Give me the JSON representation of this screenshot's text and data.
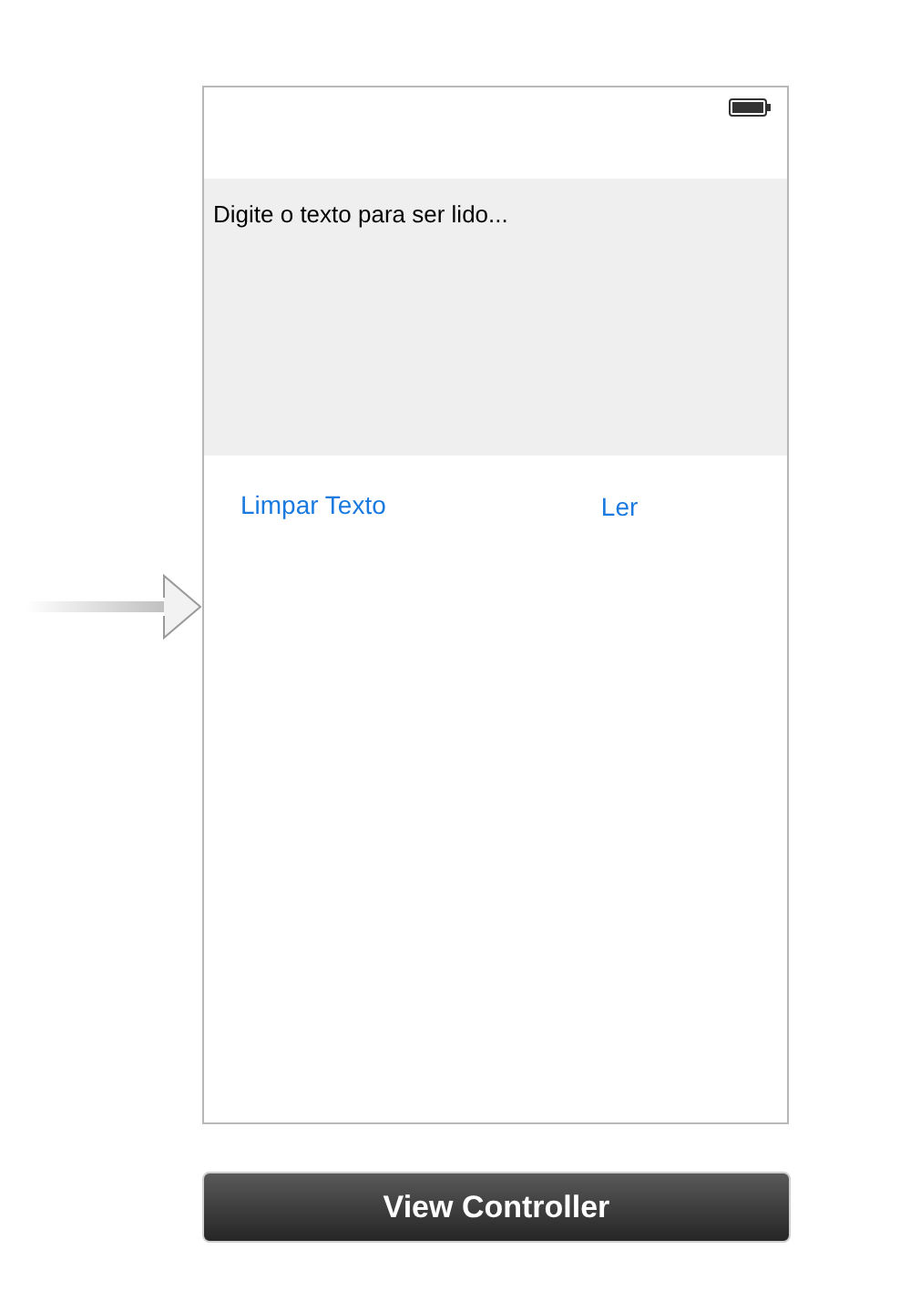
{
  "scene": {
    "text_view": {
      "text": "Digite o texto para ser lido..."
    },
    "buttons": [
      {
        "label": "Limpar Texto"
      },
      {
        "label": "Ler"
      }
    ]
  },
  "scene_title": "View Controller"
}
